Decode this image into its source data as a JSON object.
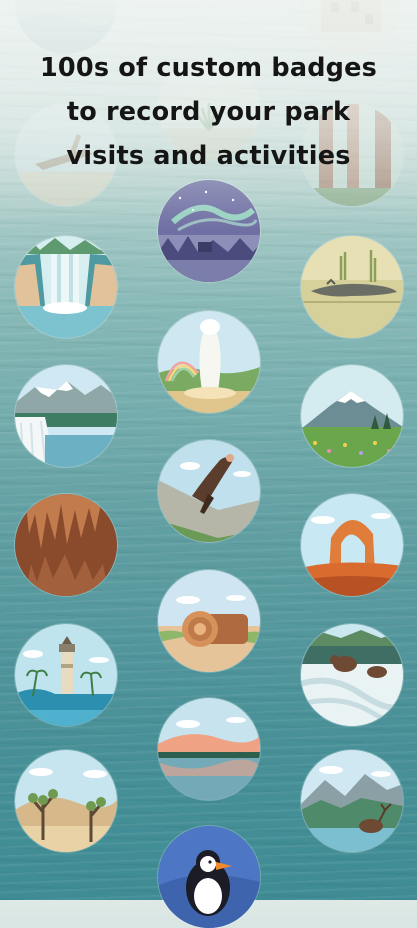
{
  "headline": "100s of custom badges\nto record your park\nvisits and activities",
  "colors": {
    "headline": "#151515",
    "water_top": "#dfe9e6",
    "water_bottom": "#3f8c94"
  },
  "badges": [
    {
      "name": "badge-misty-top-left",
      "scene": "misty"
    },
    {
      "name": "badge-cliff-dwelling",
      "scene": "cliff-dwelling"
    },
    {
      "name": "badge-desert-shrub",
      "scene": "desert-shrub"
    },
    {
      "name": "badge-driftwood",
      "scene": "driftwood"
    },
    {
      "name": "badge-redwood-forest",
      "scene": "redwood-forest"
    },
    {
      "name": "badge-northern-lights",
      "scene": "northern-lights"
    },
    {
      "name": "badge-waterfall-canyon",
      "scene": "waterfall-canyon"
    },
    {
      "name": "badge-alligator-marsh",
      "scene": "alligator-marsh"
    },
    {
      "name": "badge-geyser-rainbow",
      "scene": "geyser-rainbow"
    },
    {
      "name": "badge-glacier",
      "scene": "glacier"
    },
    {
      "name": "badge-snowy-mountain-meadow",
      "scene": "snowy-mountain-meadow"
    },
    {
      "name": "badge-condor",
      "scene": "condor"
    },
    {
      "name": "badge-cave",
      "scene": "cave"
    },
    {
      "name": "badge-delicate-arch",
      "scene": "delicate-arch"
    },
    {
      "name": "badge-petrified-log",
      "scene": "petrified-log"
    },
    {
      "name": "badge-lighthouse",
      "scene": "lighthouse"
    },
    {
      "name": "badge-bears-falls",
      "scene": "bears-falls"
    },
    {
      "name": "badge-sunset-lake",
      "scene": "sunset-lake"
    },
    {
      "name": "badge-joshua-trees",
      "scene": "joshua-trees"
    },
    {
      "name": "badge-elk-valley",
      "scene": "elk-valley"
    },
    {
      "name": "badge-puffin",
      "scene": "puffin"
    }
  ]
}
